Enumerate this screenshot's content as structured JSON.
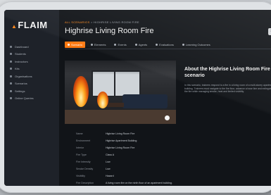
{
  "app": {
    "logo_text": "FLAIM"
  },
  "sidebar": {
    "items": [
      {
        "label": "Dashboard"
      },
      {
        "label": "Students"
      },
      {
        "label": "Instructors"
      },
      {
        "label": "Kits"
      },
      {
        "label": "Organisations"
      },
      {
        "label": "Scenarios"
      },
      {
        "label": "Settings"
      },
      {
        "label": "Online Queries"
      }
    ]
  },
  "breadcrumb": {
    "part1": "ALL SCENARIOS",
    "separator": " > ",
    "part2": "HIGHRISE LIVING ROOM FIRE"
  },
  "header": {
    "title": "Highrise Living Room Fire",
    "close_glyph": "×"
  },
  "tabs": [
    {
      "label": "Scenario",
      "active": true
    },
    {
      "label": "Elements"
    },
    {
      "label": "Events"
    },
    {
      "label": "Agents"
    },
    {
      "label": "Evaluations"
    },
    {
      "label": "Learning Outcomes"
    }
  ],
  "hero": {
    "description": "Living room fire scene with flames"
  },
  "details": [
    {
      "key": "Name",
      "value": "Highrise Living Room Fire"
    },
    {
      "key": "Environment",
      "value": "Highrise Apartment Building"
    },
    {
      "key": "Interior",
      "value": "Highrise Living Room Fire"
    },
    {
      "key": "Fire Type",
      "value": "Class A"
    },
    {
      "key": "Fire Intensity",
      "value": "Low"
    },
    {
      "key": "Smoke Density",
      "value": "Low"
    },
    {
      "key": "Visibility",
      "value": "Hazard"
    },
    {
      "key": "Fire Description",
      "value": "A living room fire on the ninth floor of an apartment building."
    }
  ],
  "about": {
    "title": "About the Highrise Living Room Fire scenario",
    "text": "In this scenario, trainees respond to a fire in a living room of a multi-storey apartment building. Trainees must navigate to the fire floor, advance a hose line and extinguish the fire while managing smoke, heat and limited visibility."
  }
}
